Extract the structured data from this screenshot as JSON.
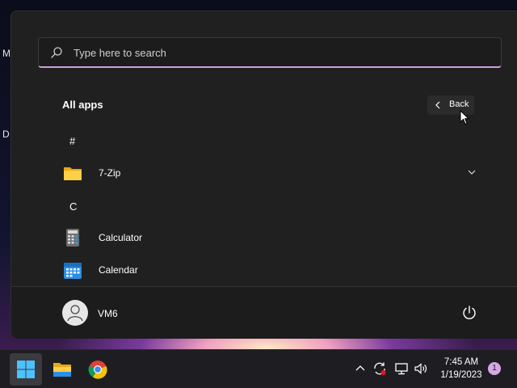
{
  "desktop": {
    "labels": [
      "M",
      "D"
    ]
  },
  "start_menu": {
    "search": {
      "placeholder": "Type here to search"
    },
    "all_apps_title": "All apps",
    "back_label": "Back",
    "sections": [
      {
        "letter": "#",
        "apps": [
          {
            "name": "7-Zip",
            "icon": "folder-icon",
            "expandable": true
          }
        ]
      },
      {
        "letter": "C",
        "apps": [
          {
            "name": "Calculator",
            "icon": "calculator-icon"
          },
          {
            "name": "Calendar",
            "icon": "calendar-icon"
          }
        ]
      }
    ],
    "user": {
      "name": "VM6",
      "icon": "user-avatar-icon"
    },
    "power_icon": "power-icon",
    "accent_color": "#c9a0dc"
  },
  "taskbar": {
    "pinned": [
      {
        "name": "Start",
        "icon": "windows-start-icon",
        "active": true
      },
      {
        "name": "File Explorer",
        "icon": "file-explorer-icon"
      },
      {
        "name": "Google Chrome",
        "icon": "chrome-icon"
      }
    ],
    "tray": [
      "chevron-up-icon",
      "sync-icon",
      "network-icon",
      "volume-icon"
    ],
    "clock": {
      "time": "7:45 AM",
      "date": "1/19/2023"
    },
    "notification_count": "1"
  }
}
